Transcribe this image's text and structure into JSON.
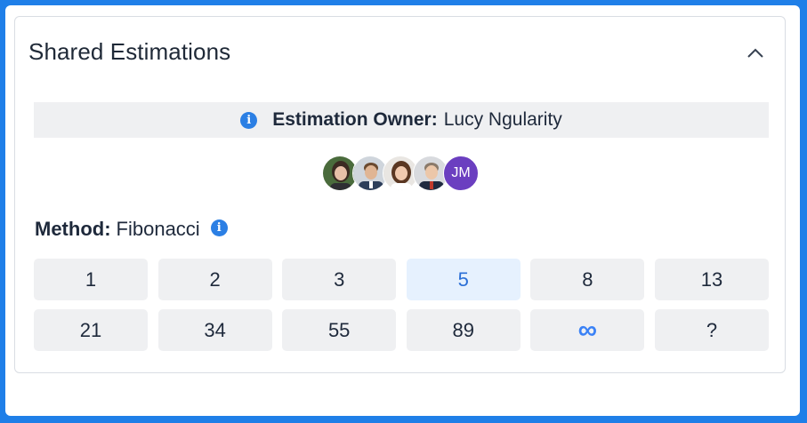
{
  "card": {
    "title": "Shared Estimations"
  },
  "owner": {
    "label": "Estimation Owner:",
    "name": "Lucy Ngularity"
  },
  "avatars": [
    {
      "name": "avatar-1"
    },
    {
      "name": "avatar-2"
    },
    {
      "name": "avatar-3"
    },
    {
      "name": "avatar-4"
    },
    {
      "name": "avatar-5",
      "initials": "JM"
    }
  ],
  "method": {
    "label": "Method:",
    "value": "Fibonacci"
  },
  "cards": [
    {
      "label": "1"
    },
    {
      "label": "2"
    },
    {
      "label": "3"
    },
    {
      "label": "5",
      "selected": true
    },
    {
      "label": "8"
    },
    {
      "label": "13"
    },
    {
      "label": "21"
    },
    {
      "label": "34"
    },
    {
      "label": "55"
    },
    {
      "label": "89"
    },
    {
      "label": "∞"
    },
    {
      "label": "?"
    }
  ],
  "colors": {
    "accent": "#2b7fe4",
    "frame": "#1f7fe8",
    "selected_bg": "#e6f1fe",
    "button_bg": "#eff0f2",
    "initials_avatar": "#6b3fc0"
  },
  "icons": {
    "collapse": "chevron-up-icon",
    "info": "info-icon"
  }
}
